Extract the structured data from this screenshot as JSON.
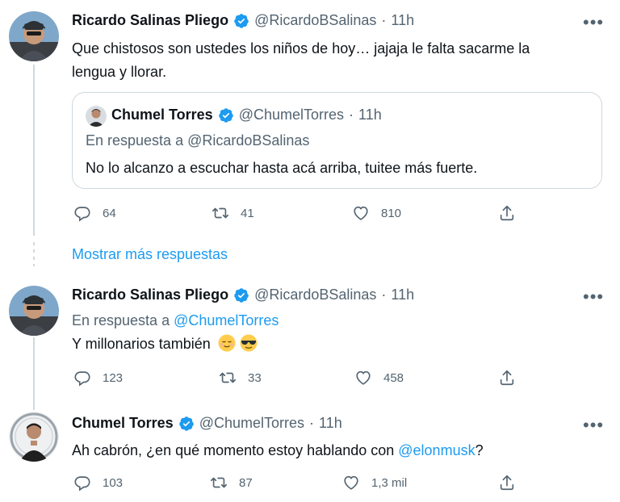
{
  "tweet1": {
    "name": "Ricardo Salinas Pliego",
    "handle": "@RicardoBSalinas",
    "time": "11h",
    "text_line1": "Que chistosos son ustedes los niños de hoy… jajaja le falta sacarme la",
    "text_line2": "lengua y llorar.",
    "quote": {
      "name": "Chumel Torres",
      "handle": "@ChumelTorres",
      "time": "11h",
      "reply_prefix": "En respuesta a",
      "reply_handle": "@RicardoBSalinas",
      "text": "No lo alcanzo a escuchar hasta acá arriba, tuitee más fuerte."
    },
    "replies": "64",
    "retweets": "41",
    "likes": "810"
  },
  "show_more": "Mostrar más respuestas",
  "tweet2": {
    "name": "Ricardo Salinas Pliego",
    "handle": "@RicardoBSalinas",
    "time": "11h",
    "reply_prefix": "En respuesta a",
    "reply_handle": "@ChumelTorres",
    "text": "Y millonarios también",
    "replies": "123",
    "retweets": "33",
    "likes": "458"
  },
  "tweet3": {
    "name": "Chumel Torres",
    "handle": "@ChumelTorres",
    "time": "11h",
    "text_prefix": "Ah cabrón, ¿en qué momento estoy hablando con ",
    "mention": "@elonmusk",
    "text_suffix": "?",
    "replies": "103",
    "retweets": "87",
    "likes": "1,3 mil"
  },
  "separator": "·",
  "more_icon": "•••",
  "colors": {
    "link": "#1d9bf0",
    "verified": "#1d9bf0",
    "secondary": "#536471"
  }
}
